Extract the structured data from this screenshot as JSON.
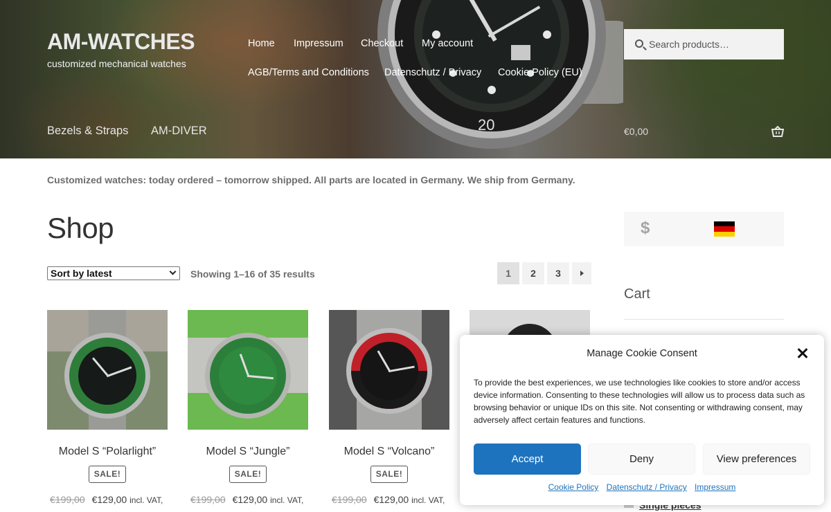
{
  "brand": {
    "title": "AM-WATCHES",
    "tagline": "customized mechanical watches"
  },
  "topnav": [
    "Home",
    "Impressum",
    "Checkout",
    "My account",
    "AGB/Terms and Conditions",
    "Datenschutz / Privacy",
    "Cookie Policy (EU)"
  ],
  "search": {
    "placeholder": "Search products…"
  },
  "subnav": [
    "Bezels & Straps",
    "AM-DIVER"
  ],
  "header_cart": {
    "total": "€0,00"
  },
  "notice": "Customized watches: today ordered – tomorrow shipped. All parts are located in Germany. We ship from Germany.",
  "page_title": "Shop",
  "sort": {
    "selected": "Sort by latest"
  },
  "result_count": "Showing 1–16 of 35 results",
  "pagination": {
    "pages": [
      "1",
      "2",
      "3"
    ],
    "current": "1"
  },
  "products": [
    {
      "name": "Model S “Polarlight”",
      "badge": "SALE!",
      "old_price": "€199,00",
      "price": "€129,00",
      "tax": "incl. VAT,"
    },
    {
      "name": "Model S “Jungle”",
      "badge": "SALE!",
      "old_price": "€199,00",
      "price": "€129,00",
      "tax": "incl. VAT,"
    },
    {
      "name": "Model S “Volcano”",
      "badge": "SALE!",
      "old_price": "€199,00",
      "price": "€129,00",
      "tax": "incl. VAT,"
    }
  ],
  "sidebar": {
    "currency_symbol": "$",
    "cart_heading": "Cart",
    "link": "Single pieces"
  },
  "cookie": {
    "title": "Manage Cookie Consent",
    "body": "To provide the best experiences, we use technologies like cookies to store and/or access device information. Consenting to these technologies will allow us to process data such as browsing behavior or unique IDs on this site. Not consenting or withdrawing consent, may adversely affect certain features and functions.",
    "accept": "Accept",
    "deny": "Deny",
    "preferences": "View preferences",
    "links": [
      "Cookie Policy",
      "Datenschutz / Privacy",
      "Impressum"
    ]
  },
  "colors": {
    "accent": "#1e73be",
    "sale_border": "#555555",
    "flag": [
      "#000000",
      "#dd0000",
      "#ffce00"
    ]
  },
  "icons": [
    "search-icon",
    "basket-icon",
    "close-icon",
    "chevron-down-icon",
    "next-page-icon",
    "german-flag-icon"
  ]
}
